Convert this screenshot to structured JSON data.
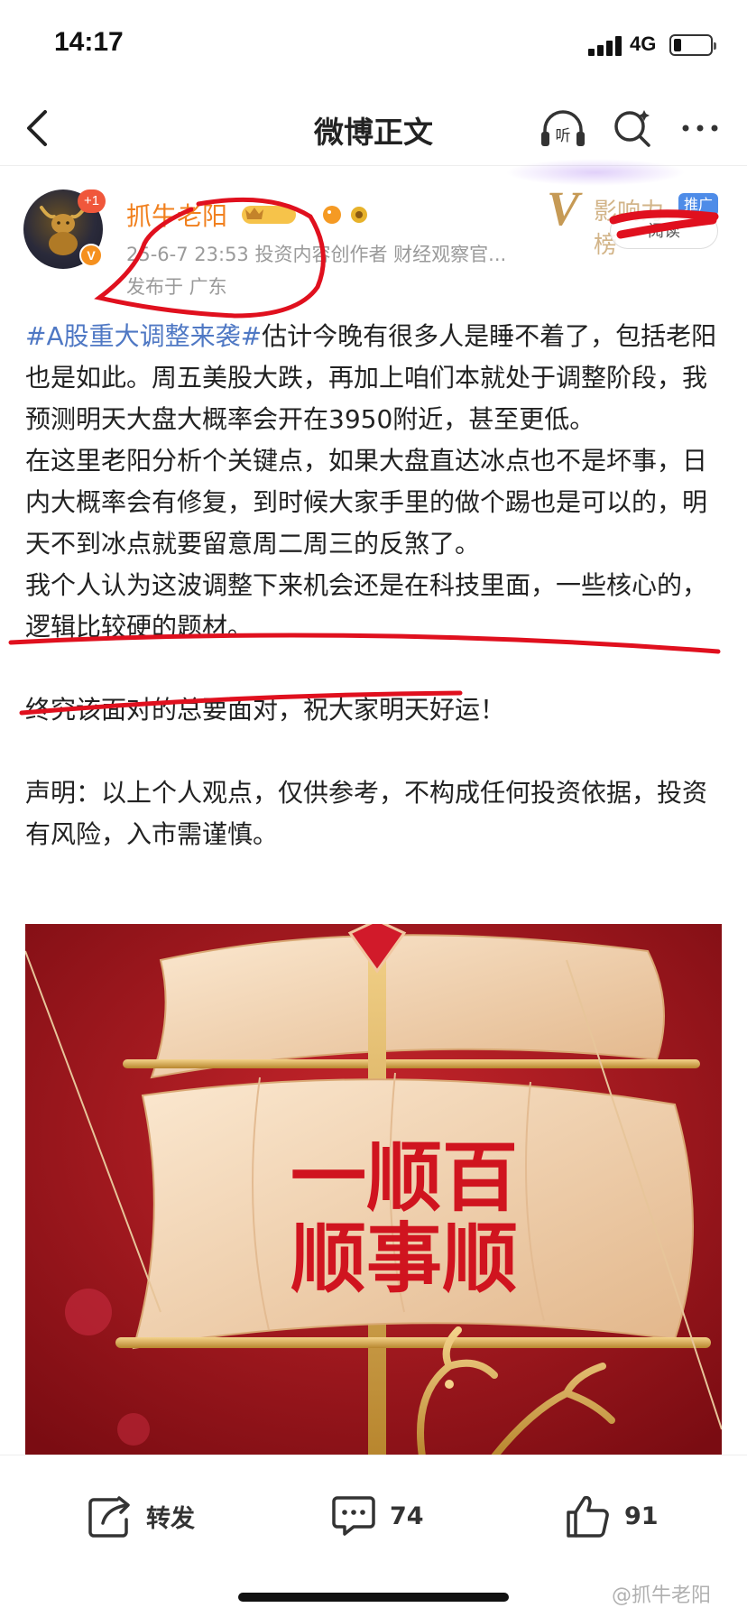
{
  "status_bar": {
    "time": "14:17",
    "network": "4G"
  },
  "nav": {
    "title": "微博正文",
    "listen_label": "听"
  },
  "author": {
    "name": "抓牛老阳",
    "follower_badge": "+1",
    "verified_mark": "V",
    "meta": "25-6-7 23:53  投资内容创作者 财经观察官...",
    "location": "发布于 广东"
  },
  "promo": {
    "brand_mark": "V",
    "brand_text": "影响力榜",
    "tag": "推广",
    "read_button": "阅读"
  },
  "post": {
    "topic": "#A股重大调整来袭#",
    "para1": "估计今晚有很多人是睡不着了，包括老阳也是如此。周五美股大跌，再加上咱们本就处于调整阶段，我预测明天大盘大概率会开在3950附近，甚至更低。",
    "para2": "在这里老阳分析个关键点，如果大盘直达冰点也不是坏事，日内大概率会有修复，到时候大家手里的做个踢也是可以的，明天不到冰点就要留意周二周三的反煞了。",
    "para3": "我个人认为这波调整下来机会还是在科技里面，一些核心的，逻辑比较硬的题材。",
    "para4": "终究该面对的总要面对，祝大家明天好运！",
    "para5": "声明：以上个人观点，仅供参考，不构成任何投资依据，投资有风险，入市需谨慎。"
  },
  "image": {
    "line1": "一顺百",
    "line2": "顺事顺"
  },
  "actions": {
    "repost_label": "转发",
    "comment_count": "74",
    "like_count": "91"
  },
  "watermark": "@抓牛老阳",
  "colors": {
    "author": "#f1801e",
    "topic": "#4f78c4",
    "annotation": "#e0101e",
    "image_bg": "#a0141c"
  }
}
